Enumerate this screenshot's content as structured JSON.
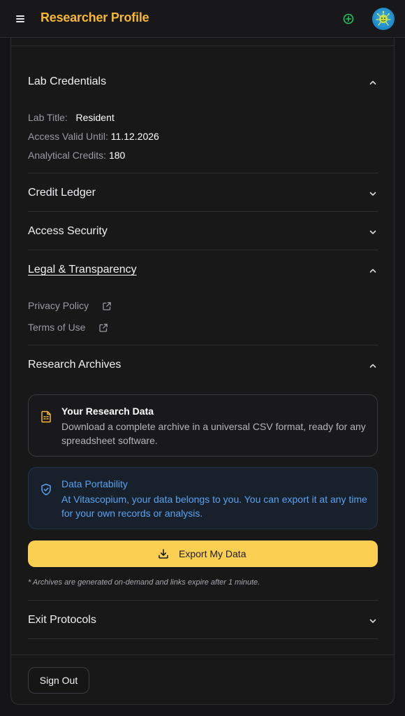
{
  "header": {
    "title": "Researcher Profile",
    "accent_color": "#f5b82e",
    "menu_icon": "hamburger-icon",
    "add_icon": "plus-circle-icon",
    "add_icon_color": "#22c55e",
    "avatar_icon": "avatar-image"
  },
  "sections": {
    "lab_credentials": {
      "title": "Lab Credentials",
      "expanded": true,
      "lab_title_label": "Lab Title:",
      "lab_title_value": "Resident",
      "access_label": "Access Valid Until:",
      "access_value": "11.12.2026",
      "credits_label": "Analytical Credits:",
      "credits_value": "180"
    },
    "credit_ledger": {
      "title": "Credit Ledger",
      "expanded": false
    },
    "access_security": {
      "title": "Access Security",
      "expanded": false
    },
    "legal": {
      "title": "Legal & Transparency",
      "expanded": true,
      "privacy_label": "Privacy Policy",
      "terms_label": "Terms of Use",
      "link_icon": "external-link-icon"
    },
    "research_archives": {
      "title": "Research Archives",
      "expanded": true,
      "data_card": {
        "title": "Your Research Data",
        "body": "Download a complete archive in a universal CSV format, ready for any spreadsheet software.",
        "icon": "spreadsheet-file-icon"
      },
      "portability_card": {
        "title": "Data Portability",
        "body": "At Vitascopium, your data belongs to you. You can export it at any time for your own records or analysis.",
        "icon": "shield-check-icon",
        "color": "#5aa2f0"
      },
      "export_button": "Export My Data",
      "export_icon": "download-icon",
      "button_color": "#fbcf52",
      "note": "* Archives are generated on-demand and links expire after 1 minute."
    },
    "exit_protocols": {
      "title": "Exit Protocols",
      "expanded": false
    }
  },
  "footer": {
    "sign_out": "Sign Out"
  }
}
